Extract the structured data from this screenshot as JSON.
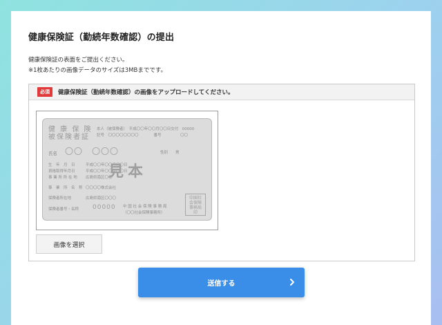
{
  "title": "健康保険証（勤続年数確認）の提出",
  "description": {
    "line1": "健康保険証の表面をご提出ください。",
    "line2": "※1枚あたりの画像データのサイズは3MBまでです。"
  },
  "upload": {
    "required_badge": "必須",
    "label": "健康保険証（勤続年数確認）の画像をアップロードしてください。",
    "select_button": "画像を選択"
  },
  "sample_card": {
    "title_line1": "健 康 保 険",
    "title_line2": "被保険者証",
    "insured_line": "本人（被保険者）　平成〇〇年〇〇月〇〇日交付　00000",
    "symbol_line": "記号　〇〇〇〇〇〇〇〇　　　　番号　　　　　〇〇",
    "name_label": "氏名",
    "name_value": "〇〇　〇〇〇",
    "gender_label": "性別　　男",
    "birth_label": "生　年　月　日",
    "birth_value": "平成〇〇年〇〇月〇〇日",
    "acquired_label": "資格取得年月日",
    "acquired_value": "平成〇〇年〇〇月〇〇日",
    "office_addr_label": "事 業 所 所 在 地",
    "office_addr_value": "広島県南区〇〇",
    "office_name_label": "事　業　所　名　称",
    "office_name_value": "〇〇〇〇株式会社",
    "insurer_addr_label": "保険者所在地",
    "insurer_addr_value": "広島県南区〇〇〇",
    "insurer_no_label": "保険者番号・名称",
    "insurer_no_value": "00000",
    "insurer_name": "中 国 社 会 保 険 事 務 局",
    "insurer_sub": "（〇〇社会保険事務所）",
    "watermark": "見本",
    "seal_text": "中国社会保険事務局印"
  },
  "submit": {
    "label": "送信する",
    "icon": "chevron-right-icon"
  },
  "colors": {
    "accent": "#3a8ee8",
    "required": "#e03a3a"
  }
}
